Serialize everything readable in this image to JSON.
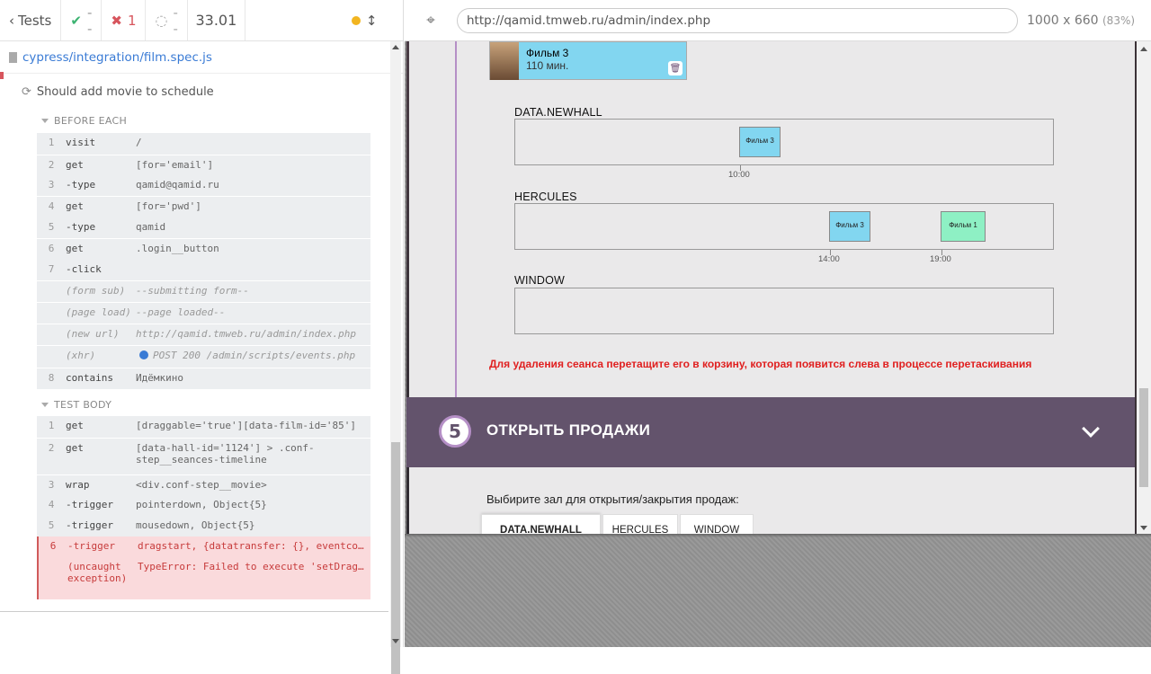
{
  "reporter": {
    "tests_label": "Tests",
    "passed": "--",
    "failed": "1",
    "pending": "--",
    "duration": "33.01",
    "spec_file": "cypress/integration/film.spec.js",
    "test_title": "Should add movie to schedule",
    "before_each_label": "BEFORE EACH",
    "before_each": [
      {
        "num": "1",
        "name": "visit",
        "msg": "/"
      },
      {
        "num": "2",
        "name": "get",
        "msg": "[for='email']"
      },
      {
        "num": "3",
        "name": " -type",
        "msg": "qamid@qamid.ru"
      },
      {
        "num": "4",
        "name": "get",
        "msg": "[for='pwd']"
      },
      {
        "num": "5",
        "name": " -type",
        "msg": "qamid"
      },
      {
        "num": "6",
        "name": "get",
        "msg": ".login__button"
      },
      {
        "num": "7",
        "name": " -click",
        "msg": ""
      },
      {
        "num": "",
        "name": "(form sub)",
        "msg": "--submitting form--"
      },
      {
        "num": "",
        "name": "(page load)",
        "msg": "--page loaded--"
      },
      {
        "num": "",
        "name": "(new url)",
        "msg": "http://qamid.tmweb.ru/admin/index.php"
      },
      {
        "num": "",
        "name": "(xhr)",
        "msg": "POST 200 /admin/scripts/events.php"
      },
      {
        "num": "8",
        "name": "contains",
        "msg": "Идёмкино"
      }
    ],
    "test_body_label": "TEST BODY",
    "test_body": [
      {
        "num": "1",
        "name": "get",
        "msg": "[draggable='true'][data-film-id='85']"
      },
      {
        "num": "2",
        "name": "get",
        "msg": "[data-hall-id='1124'] > .conf-step__seances-timeline"
      },
      {
        "num": "3",
        "name": "wrap",
        "msg": "<div.conf-step__movie>"
      },
      {
        "num": "4",
        "name": " -trigger",
        "msg": "pointerdown, Object{5}"
      },
      {
        "num": "5",
        "name": " -trigger",
        "msg": "mousedown, Object{5}"
      },
      {
        "num": "6",
        "name": " -trigger",
        "msg": "dragstart, {datatransfer: {}, eventco…"
      },
      {
        "num": "",
        "name": "(uncaught exception)",
        "msg": "TypeError: Failed to execute 'setDrag…"
      }
    ]
  },
  "browser": {
    "url": "http://qamid.tmweb.ru/admin/index.php",
    "viewport": "1000 x 660",
    "scale": "(83%)"
  },
  "app": {
    "film_card": {
      "title": "Фильм 3",
      "duration": "110 мин."
    },
    "halls": [
      {
        "name": "DATA.NEWHALL",
        "seances": [
          {
            "film": "Фильм 3",
            "time": "10:00",
            "color": "#82d6f0"
          }
        ]
      },
      {
        "name": "HERCULES",
        "seances": [
          {
            "film": "Фильм 3",
            "time": "14:00",
            "color": "#82d6f0"
          },
          {
            "film": "Фильм 1",
            "time": "19:00",
            "color": "#8ef0c4"
          }
        ]
      },
      {
        "name": "WINDOW",
        "seances": []
      }
    ],
    "delete_hint": "Для удаления сеанса перетащите его в корзину, которая появится слева в процессе перетаскивания",
    "step": {
      "number": "5",
      "title": "ОТКРЫТЬ ПРОДАЖИ"
    },
    "sales_label": "Выбирите зал для открытия/закрытия продаж:",
    "sales_tabs": [
      "DATA.NEWHALL",
      "HERCULES",
      "WINDOW"
    ]
  },
  "colors": {
    "accent": "#63536c",
    "error": "#d7555d",
    "link": "#3a7bd5",
    "hint": "#e02020"
  }
}
